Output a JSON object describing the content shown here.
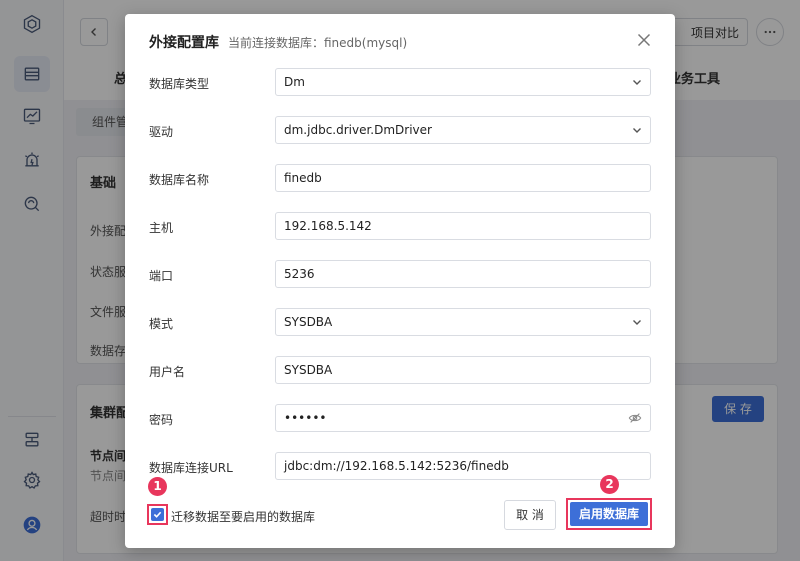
{
  "background": {
    "compare_label": "项目对比",
    "tab_left_stub": "总",
    "tab_right_stub": "业务工具",
    "pill_stub": "组件管",
    "section1_head_stub": "基础",
    "section1_rows": [
      "外接配",
      "状态服",
      "文件服",
      "数据存"
    ],
    "section2_head_stub": "集群配",
    "section2_rows": [
      "节点间",
      "节点间",
      "超时时"
    ],
    "save_label": "保 存"
  },
  "dialog": {
    "title": "外接配置库",
    "subtitle": "当前连接数据库：finedb(mysql)",
    "fields": [
      {
        "label": "数据库类型",
        "value": "Dm",
        "kind": "select"
      },
      {
        "label": "驱动",
        "value": "dm.jdbc.driver.DmDriver",
        "kind": "select"
      },
      {
        "label": "数据库名称",
        "value": "finedb",
        "kind": "text"
      },
      {
        "label": "主机",
        "value": "192.168.5.142",
        "kind": "text"
      },
      {
        "label": "端口",
        "value": "5236",
        "kind": "text"
      },
      {
        "label": "模式",
        "value": "SYSDBA",
        "kind": "select"
      },
      {
        "label": "用户名",
        "value": "SYSDBA",
        "kind": "text"
      },
      {
        "label": "密码",
        "value": "••••••",
        "kind": "password"
      },
      {
        "label": "数据库连接URL",
        "value": "jdbc:dm://192.168.5.142:5236/finedb",
        "kind": "text"
      }
    ],
    "migrate_label": "迁移数据至要启用的数据库",
    "cancel_label": "取 消",
    "enable_label": "启用数据库",
    "badge1": "1",
    "badge2": "2"
  },
  "colors": {
    "accent": "#3d6fd8",
    "highlight": "#e8365c"
  }
}
